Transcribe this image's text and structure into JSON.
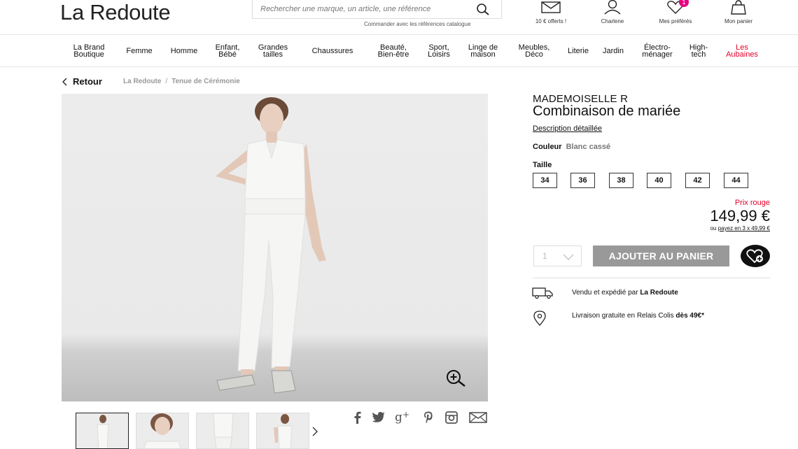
{
  "header": {
    "logo": "La Redoute",
    "search_placeholder": "Rechercher une marque, un article, une référence",
    "catalog_link": "Commander avec les références catalogue",
    "icons": {
      "offer": {
        "label": "10 € offerts !",
        "icon": "envelope-icon"
      },
      "account": {
        "label": "Charlene",
        "icon": "user-icon"
      },
      "favorites": {
        "label": "Mes préférés",
        "icon": "heart-icon",
        "badge": "1"
      },
      "cart": {
        "label": "Mon panier",
        "icon": "shopping-bag-icon"
      }
    },
    "badge_color": "#e6007e"
  },
  "nav": {
    "items": [
      {
        "label": "La Brand\nBoutique"
      },
      {
        "label": "Femme"
      },
      {
        "label": "Homme"
      },
      {
        "label": "Enfant,\nBébé"
      },
      {
        "label": "Grandes\ntailles"
      },
      {
        "label": "Chaussures"
      },
      {
        "label": "Beauté,\nBien-être"
      },
      {
        "label": "Sport,\nLoisirs"
      },
      {
        "label": "Linge de\nmaison"
      },
      {
        "label": "Meubles,\nDéco"
      },
      {
        "label": "Literie"
      },
      {
        "label": "Jardin"
      },
      {
        "label": "Électro-\nménager"
      },
      {
        "label": "High-\ntech"
      },
      {
        "label": "Les\nAubaines"
      }
    ],
    "highlight_color": "#e4002b"
  },
  "breadcrumb": {
    "back": "Retour",
    "items": [
      "La Redoute",
      "Tenue de Cérémonie"
    ],
    "separator": "/"
  },
  "product": {
    "brand": "MADEMOISELLE R",
    "title": "Combinaison de mariée",
    "description_link": "Description détaillée",
    "color_label": "Couleur",
    "color_value": "Blanc cassé",
    "size_label": "Taille",
    "sizes": [
      "34",
      "36",
      "38",
      "40",
      "42",
      "44"
    ],
    "price_tag": "Prix rouge",
    "price": "149,99 €",
    "installment_prefix": "ou ",
    "installment_link": "payez en 3 x 49,99 €",
    "quantity": "1",
    "add_to_cart": "AJOUTER AU PANIER",
    "seller_prefix": "Vendu et expédié par ",
    "seller_name": "La Redoute",
    "delivery_prefix": "Livraison gratuite en Relais Colis ",
    "delivery_bold": "dès 49€*"
  },
  "gallery": {
    "thumbnails": 4,
    "active": 0,
    "share_icons": [
      "facebook-icon",
      "twitter-icon",
      "google-plus-icon",
      "pinterest-icon",
      "instagram-icon",
      "mail-icon"
    ]
  }
}
